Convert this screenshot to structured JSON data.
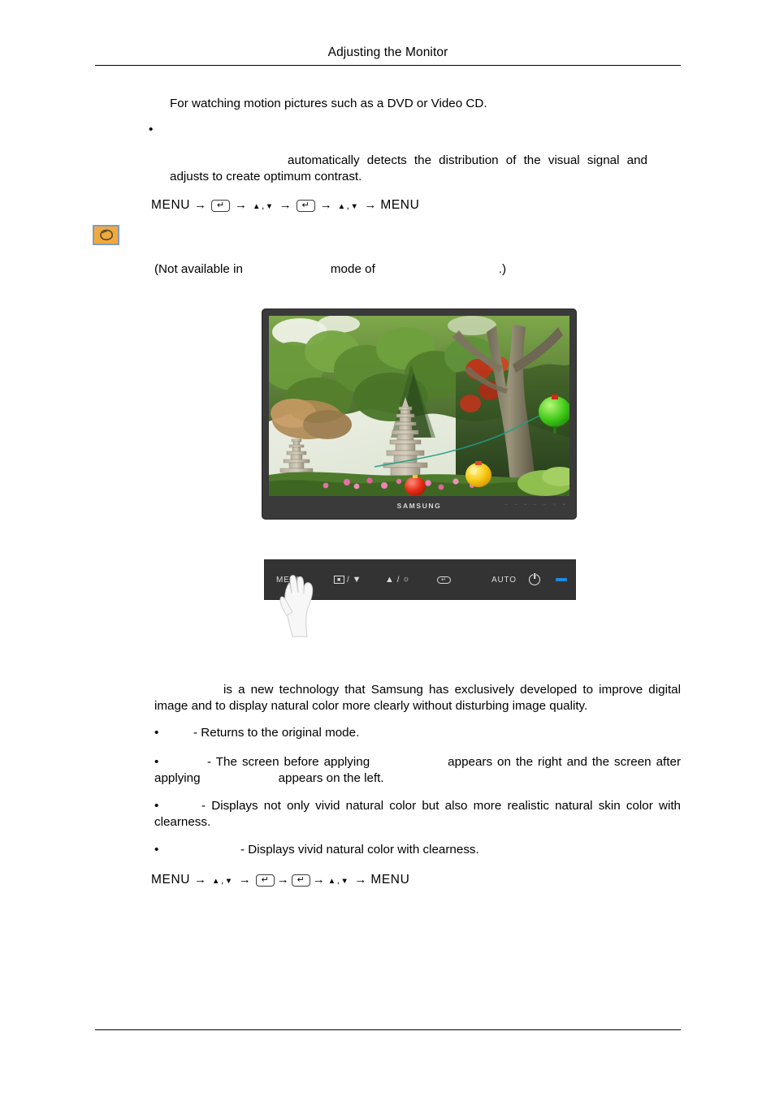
{
  "header": {
    "title": "Adjusting the Monitor"
  },
  "intro": {
    "line": "For watching motion pictures such as a DVD or Video CD."
  },
  "bullet_top": {
    "marker": "•",
    "label": "",
    "body_part1": "",
    "body_part2": "automatically detects the distribution of the visual signal and adjusts to create optimum contrast."
  },
  "menu_path_1": {
    "start": "MENU",
    "end": "MENU",
    "arrow": "→",
    "enter_glyph": "↵",
    "up_glyph": "▲",
    "down_glyph": "▼",
    "separator": ",",
    "steps": [
      "enter",
      "updown",
      "enter",
      "updown"
    ]
  },
  "note": {
    "icon_name": "note-icon",
    "icon_bg": "#f2a93b",
    "icon_border": "#7e9ec0",
    "text_before": "(Not available in",
    "text_mode": "",
    "text_middle": "mode of",
    "text_device": "",
    "text_after": ".)"
  },
  "monitor": {
    "brand": "SAMSUNG",
    "bezel_color": "#3a3a3a",
    "screen_alt": "Garden scene with stone pagoda, trees and colored lanterns",
    "bezel_key_glyphs": [
      "–",
      "–",
      "•",
      "–",
      "–",
      "○",
      "•"
    ]
  },
  "control_panel": {
    "background": "#333333",
    "led_color": "#1f8ae0",
    "buttons": [
      {
        "name": "menu-button",
        "label": "MENU"
      },
      {
        "name": "source-down-button",
        "label": "/",
        "icon": "source-box",
        "arrow": "▼"
      },
      {
        "name": "up-brightness-button",
        "label": "/",
        "arrow": "▲",
        "icon": "brightness"
      },
      {
        "name": "enter-button",
        "label": "",
        "icon": "enter-key"
      },
      {
        "name": "auto-button",
        "label": "AUTO"
      },
      {
        "name": "power-button",
        "label": "",
        "icon": "power"
      },
      {
        "name": "power-led",
        "label": "",
        "icon": "led"
      }
    ]
  },
  "description": {
    "lead_blank": "",
    "paragraph": "is a new technology that Samsung has exclusively developed to improve digital image and to display natural color more clearly without disturbing image quality."
  },
  "bullets": [
    {
      "marker": "•",
      "term": "",
      "text": "- Returns to the original mode."
    },
    {
      "marker": "•",
      "term": "",
      "text": "- The screen before applying",
      "text2": "appears on the right and the screen after applying",
      "text3": "appears on the left."
    },
    {
      "marker": "•",
      "term": "",
      "text": "- Displays not only vivid natural color but also more realistic natural skin color with clearness."
    },
    {
      "marker": "•",
      "term": "",
      "text": "- Displays vivid natural color with clearness."
    }
  ],
  "menu_path_2": {
    "start": "MENU",
    "end": "MENU",
    "arrow": "→",
    "enter_glyph": "↵",
    "up_glyph": "▲",
    "down_glyph": "▼",
    "separator": ",",
    "steps": [
      "updown",
      "enter",
      "enter",
      "updown"
    ]
  }
}
